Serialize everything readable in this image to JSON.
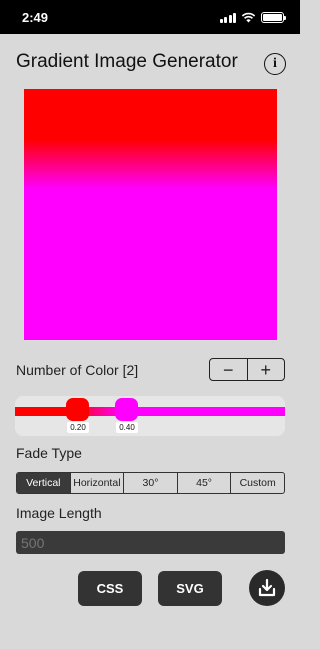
{
  "status": {
    "time": "2:49"
  },
  "app": {
    "title": "Gradient Image Generator",
    "info_icon": "info-icon"
  },
  "gradient": {
    "colors": [
      "#ff0000",
      "#ff00ff"
    ],
    "stops": [
      "0.20",
      "0.40"
    ],
    "direction": "vertical"
  },
  "colors_control": {
    "label": "Number of Color [2]",
    "minus": "−",
    "plus": "+"
  },
  "fade": {
    "label": "Fade Type",
    "options": [
      "Vertical",
      "Horizontal",
      "30°",
      "45°",
      "Custom"
    ],
    "selected": "Vertical"
  },
  "length": {
    "label": "Image Length",
    "placeholder": "500"
  },
  "actions": {
    "css": "CSS",
    "svg": "SVG",
    "download_icon": "download-icon"
  }
}
